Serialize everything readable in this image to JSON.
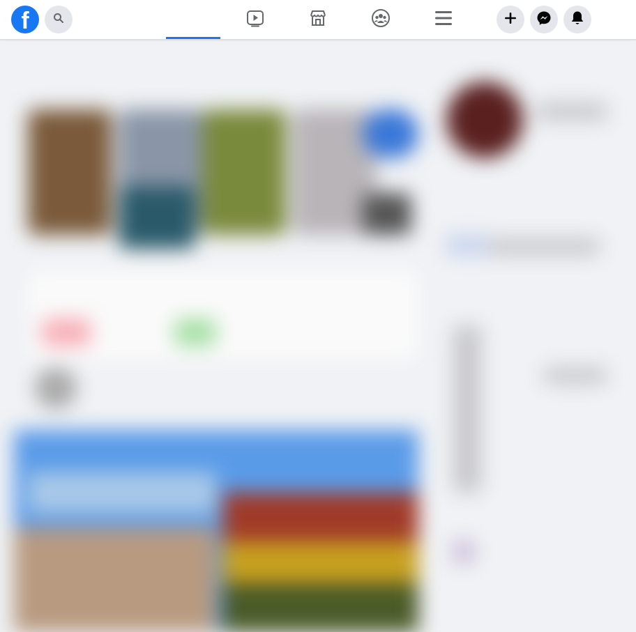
{
  "header": {
    "logo_letter": "f",
    "icons": {
      "search": "search-icon",
      "home": "home-icon",
      "watch": "video-icon",
      "marketplace": "shop-icon",
      "groups": "groups-icon",
      "menu": "menu-icon",
      "create": "plus-icon",
      "messenger": "messenger-icon",
      "notifications": "bell-icon"
    }
  },
  "colors": {
    "brand": "#1877f2",
    "button_bg": "#e4e6eb",
    "page_bg": "#f0f2f5",
    "icon": "#050505",
    "nav_icon": "#65676b"
  }
}
